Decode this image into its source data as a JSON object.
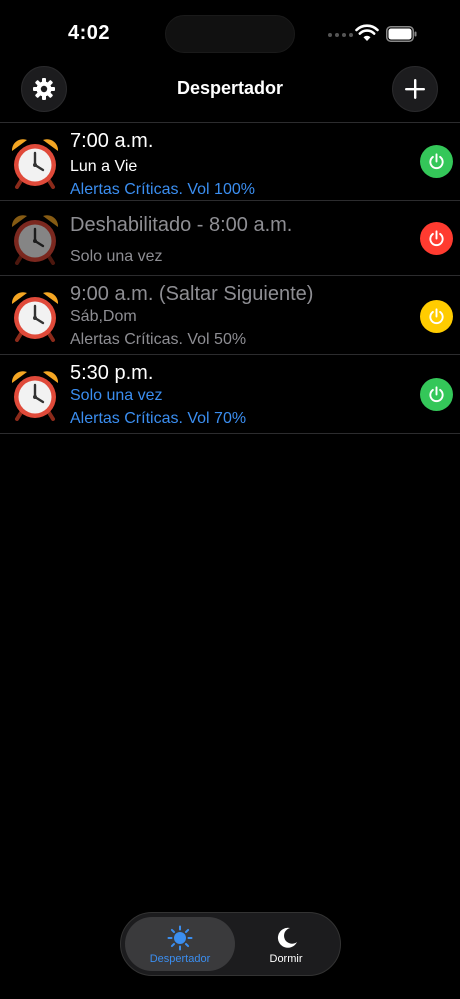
{
  "status_bar": {
    "time": "4:02"
  },
  "nav": {
    "title": "Despertador"
  },
  "alarms": [
    {
      "time": "7:00 a.m.",
      "line2": "Lun a Vie",
      "line3": "Alertas Críticas. Vol 100%",
      "enabled": true,
      "power_color": "#34c759"
    },
    {
      "time": "Deshabilitado - 8:00 a.m.",
      "line2": "Solo una vez",
      "enabled": false,
      "power_color": "#ff3b30"
    },
    {
      "time": "9:00 a.m. (Saltar Siguiente)",
      "line2": "Sáb,Dom",
      "line3": "Alertas Críticas. Vol 50%",
      "enabled": true,
      "power_color": "#ffcc00"
    },
    {
      "time": "5:30 p.m.",
      "line2": "Solo una vez",
      "line3": "Alertas Críticas. Vol 70%",
      "enabled": true,
      "power_color": "#34c759"
    }
  ],
  "tabbar": {
    "tabs": [
      {
        "label": "Despertador",
        "icon": "sun-icon",
        "active": true
      },
      {
        "label": "Dormir",
        "icon": "moon-icon",
        "active": false
      }
    ]
  },
  "colors": {
    "accent_blue": "#3b8ef0",
    "background": "#000000",
    "secondary_gray": "#8e8e93"
  }
}
